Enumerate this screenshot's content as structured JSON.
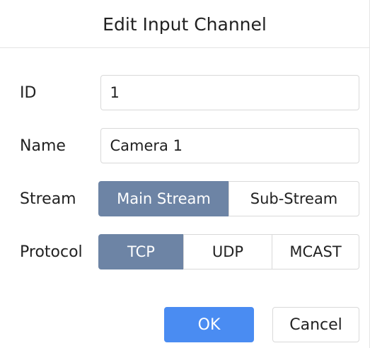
{
  "dialog": {
    "title": "Edit Input Channel"
  },
  "form": {
    "id": {
      "label": "ID",
      "value": "1"
    },
    "name": {
      "label": "Name",
      "value": "Camera 1"
    },
    "stream": {
      "label": "Stream",
      "options": [
        "Main Stream",
        "Sub-Stream"
      ],
      "selected": "Main Stream"
    },
    "protocol": {
      "label": "Protocol",
      "options": [
        "TCP",
        "UDP",
        "MCAST"
      ],
      "selected": "TCP"
    }
  },
  "footer": {
    "ok_label": "OK",
    "cancel_label": "Cancel"
  },
  "colors": {
    "selected_segment": "#6d84a5",
    "primary_button": "#4a8cf2"
  }
}
